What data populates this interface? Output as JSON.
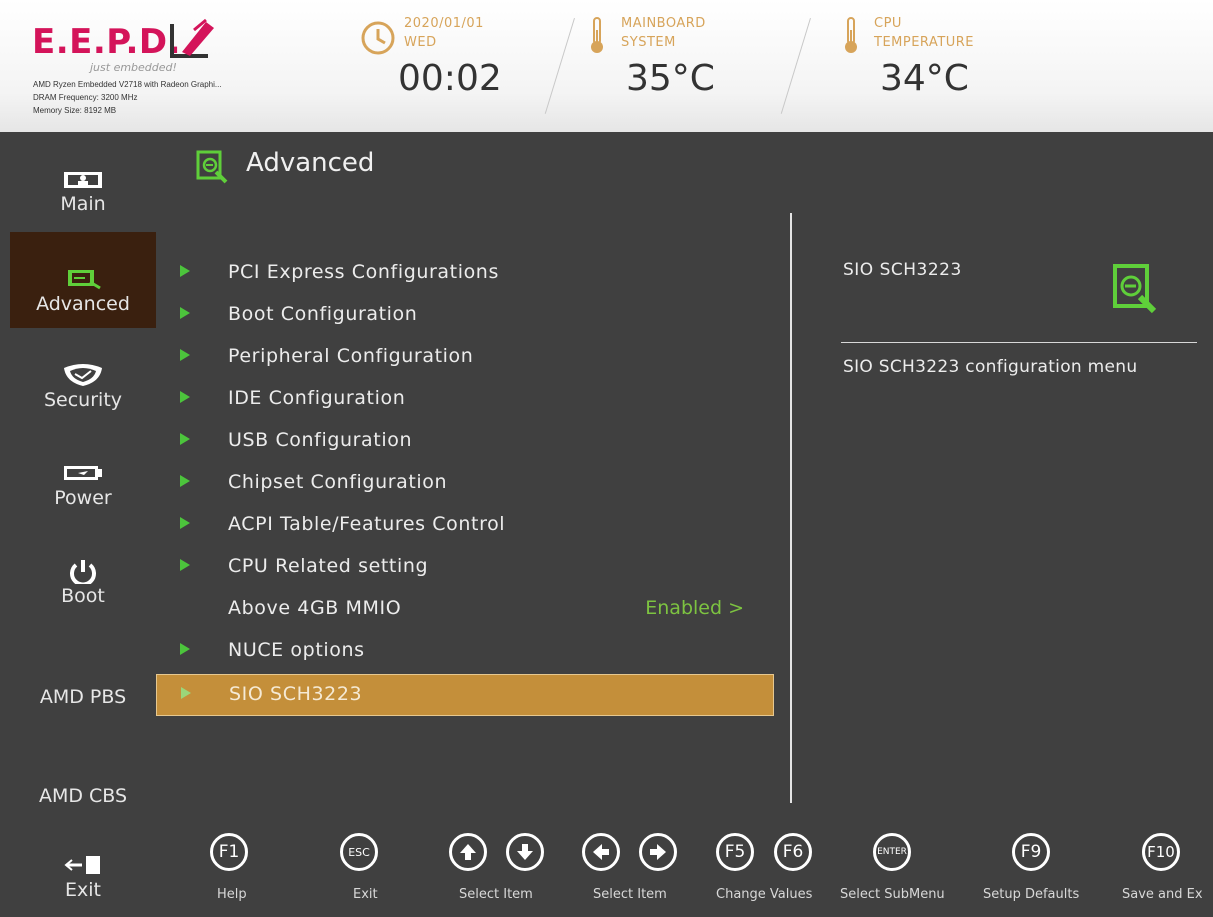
{
  "brand": {
    "logo": "E.E.P.D.",
    "tagline": "just embedded!",
    "sysinfo": [
      "AMD Ryzen Embedded V2718 with Radeon Graphi...",
      "DRAM Frequency: 3200 MHz",
      "Memory Size: 8192 MB"
    ]
  },
  "header": {
    "date": "2020/01/01",
    "weekday": "WED",
    "time": "00:02",
    "mainboard_label1": "MAINBOARD",
    "mainboard_label2": "SYSTEM",
    "mainboard_temp": "35°C",
    "cpu_label1": "CPU",
    "cpu_label2": "TEMPERATURE",
    "cpu_temp": "34°C"
  },
  "sidebar": {
    "items": [
      {
        "label": "Main"
      },
      {
        "label": "Advanced"
      },
      {
        "label": "Security"
      },
      {
        "label": "Power"
      },
      {
        "label": "Boot"
      },
      {
        "label": "AMD PBS"
      },
      {
        "label": "AMD CBS"
      },
      {
        "label": "Exit"
      }
    ]
  },
  "main": {
    "title": "Advanced",
    "items": [
      {
        "label": "PCI Express Configurations"
      },
      {
        "label": "Boot Configuration"
      },
      {
        "label": "Peripheral Configuration"
      },
      {
        "label": "IDE Configuration"
      },
      {
        "label": "USB Configuration"
      },
      {
        "label": "Chipset Configuration"
      },
      {
        "label": "ACPI Table/Features Control"
      },
      {
        "label": "CPU Related setting"
      },
      {
        "label": "Above 4GB MMIO",
        "value": "Enabled >"
      },
      {
        "label": "NUCE options"
      },
      {
        "label": "SIO SCH3223"
      }
    ]
  },
  "help": {
    "title": "SIO SCH3223",
    "text": "SIO SCH3223 configuration menu"
  },
  "footer": {
    "keys": [
      {
        "key": "F1",
        "label": "Help"
      },
      {
        "key": "ESC",
        "label": "Exit"
      },
      {
        "key": "",
        "label": "Select Item"
      },
      {
        "key": "",
        "label": "Select Item"
      },
      {
        "key": "F5",
        "label": ""
      },
      {
        "key": "F6",
        "label": "Change Values"
      },
      {
        "key": "ENTER",
        "label": "Select  SubMenu"
      },
      {
        "key": "F9",
        "label": "Setup Defaults"
      },
      {
        "key": "F10",
        "label": "Save and Ex"
      }
    ]
  },
  "colors": {
    "brand": "#d4145a",
    "selection": "#c48f3a",
    "arrow": "#4cc43c",
    "value": "#7dc341",
    "header_accent": "#d7a45a"
  }
}
